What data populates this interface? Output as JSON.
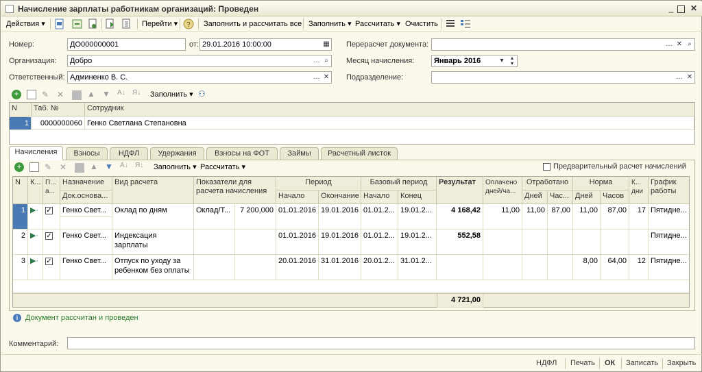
{
  "window": {
    "title": "Начисление зарплаты работникам организаций: Проведен"
  },
  "toolbar": {
    "actions": "Действия",
    "goto": "Перейти",
    "fill_calc_all": "Заполнить и рассчитать все",
    "fill": "Заполнить",
    "calculate": "Рассчитать",
    "clear": "Очистить"
  },
  "form": {
    "number_label": "Номер:",
    "number": "ДО000000001",
    "from_label": "от:",
    "date": "29.01.2016 10:00:00",
    "org_label": "Организация:",
    "org": "Добро",
    "resp_label": "Ответственный:",
    "resp": "Админенко В. С.",
    "recalc_label": "Перерасчет документа:",
    "recalc": "",
    "month_label": "Месяц начисления:",
    "month": "Январь 2016",
    "dept_label": "Подразделение:",
    "dept": ""
  },
  "employees": {
    "fill_label": "Заполнить",
    "headers": [
      "N",
      "Таб. №",
      "Сотрудник"
    ],
    "rows": [
      {
        "n": "1",
        "tab": "0000000060",
        "name": "Генко Светлана Степановна"
      }
    ]
  },
  "tabs": [
    "Начисления",
    "Взносы",
    "НДФЛ",
    "Удержания",
    "Взносы на ФОТ",
    "Займы",
    "Расчетный листок"
  ],
  "accruals": {
    "fill_label": "Заполнить",
    "calc_label": "Рассчитать",
    "prelim_label": "Предварительный расчет начислений",
    "headers": {
      "n": "N",
      "k": "К...",
      "p": "П... а...",
      "purpose": "Назначение",
      "doc": "Док.основа...",
      "type": "Вид расчета",
      "indicators": "Показатели для расчета начисления",
      "period": "Период",
      "start": "Начало",
      "end": "Окончание",
      "base_period": "Базовый период",
      "base_start": "Начало",
      "base_end": "Конец",
      "result": "Результат",
      "paid": "Оплачено дней/ча...",
      "worked": "Отработано",
      "days": "Дней",
      "hours": "Час...",
      "norm": "Норма",
      "norm_days": "Дней",
      "norm_hours": "Часов",
      "kdays": "К... дни",
      "schedule": "График работы"
    },
    "rows": [
      {
        "n": "1",
        "purpose": "Генко Свет...",
        "type": "Оклад по дням",
        "ind_name": "Оклад/Т...",
        "ind_value": "7 200,000",
        "start": "01.01.2016",
        "end": "19.01.2016",
        "bstart": "01.01.2...",
        "bend": "19.01.2...",
        "result": "4 168,42",
        "paid": "11,00",
        "wdays": "11,00",
        "whours": "87,00",
        "ndays": "11,00",
        "nhours": "87,00",
        "kd": "17",
        "sched": "Пятидне..."
      },
      {
        "n": "2",
        "purpose": "Генко Свет...",
        "type": "Индексация зарплаты",
        "ind_name": "",
        "ind_value": "",
        "start": "01.01.2016",
        "end": "19.01.2016",
        "bstart": "01.01.2...",
        "bend": "19.01.2...",
        "result": "552,58",
        "paid": "",
        "wdays": "",
        "whours": "",
        "ndays": "",
        "nhours": "",
        "kd": "",
        "sched": "Пятидне..."
      },
      {
        "n": "3",
        "purpose": "Генко Свет...",
        "type": "Отпуск по уходу за ребенком без оплаты",
        "ind_name": "",
        "ind_value": "",
        "start": "20.01.2016",
        "end": "31.01.2016",
        "bstart": "20.01.2...",
        "bend": "31.01.2...",
        "result": "",
        "paid": "",
        "wdays": "",
        "whours": "",
        "ndays": "8,00",
        "nhours": "64,00",
        "kd": "12",
        "sched": "Пятидне..."
      }
    ],
    "total": "4 721,00"
  },
  "info": "Документ рассчитан и проведен",
  "comment_label": "Комментарий:",
  "comment": "",
  "status": {
    "ndfl": "НДФЛ",
    "print": "Печать",
    "ok": "ОК",
    "save": "Записать",
    "close": "Закрыть"
  }
}
